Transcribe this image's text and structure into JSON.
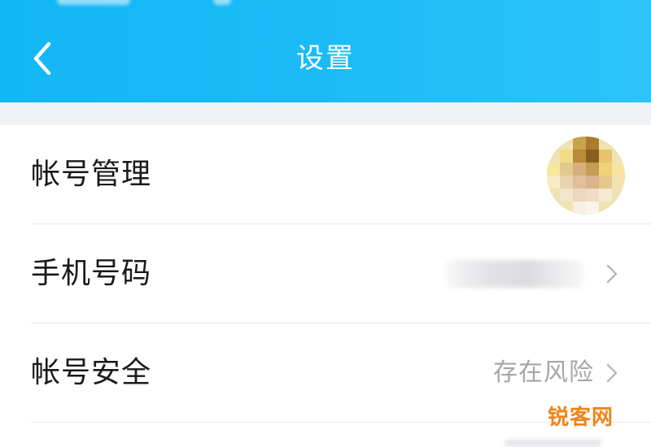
{
  "header": {
    "title": "设置",
    "back_icon": "chevron-left-icon",
    "background_color": "#12b7f5"
  },
  "settings": {
    "rows": [
      {
        "label": "帐号管理",
        "trailing": "avatar-image"
      },
      {
        "label": "手机号码",
        "trailing": "masked-value",
        "chevron_icon": "chevron-right-icon"
      },
      {
        "label": "帐号安全",
        "value": "存在风险",
        "chevron_icon": "chevron-right-icon"
      }
    ]
  },
  "watermark": {
    "text": "锐客网",
    "color": "#f08319"
  },
  "colors": {
    "text_primary": "#1a1a1a",
    "text_secondary": "#a6a6aa",
    "separator": "#e8e8ea",
    "page_gap": "#f1f2f4"
  }
}
